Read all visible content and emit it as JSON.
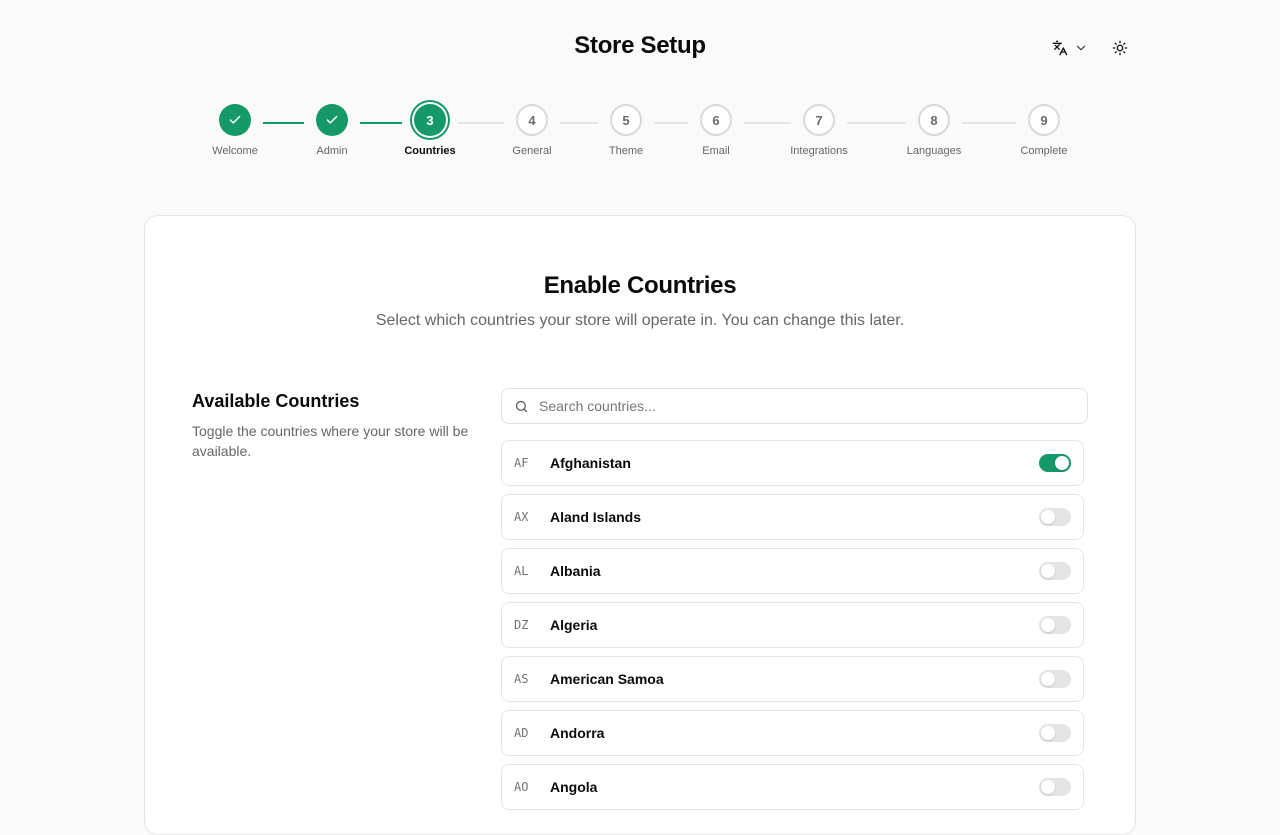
{
  "header": {
    "title": "Store Setup"
  },
  "colors": {
    "accent": "#169968"
  },
  "steps": [
    {
      "number": "1",
      "label": "Welcome",
      "state": "done"
    },
    {
      "number": "2",
      "label": "Admin",
      "state": "done"
    },
    {
      "number": "3",
      "label": "Countries",
      "state": "active"
    },
    {
      "number": "4",
      "label": "General",
      "state": "todo"
    },
    {
      "number": "5",
      "label": "Theme",
      "state": "todo"
    },
    {
      "number": "6",
      "label": "Email",
      "state": "todo"
    },
    {
      "number": "7",
      "label": "Integrations",
      "state": "todo"
    },
    {
      "number": "8",
      "label": "Languages",
      "state": "todo"
    },
    {
      "number": "9",
      "label": "Complete",
      "state": "todo"
    }
  ],
  "card": {
    "title": "Enable Countries",
    "subtitle": "Select which countries your store will operate in. You can change this later."
  },
  "side": {
    "title": "Available Countries",
    "description": "Toggle the countries where your store will be available."
  },
  "search": {
    "placeholder": "Search countries..."
  },
  "countries": [
    {
      "code": "AF",
      "name": "Afghanistan",
      "enabled": true
    },
    {
      "code": "AX",
      "name": "Aland Islands",
      "enabled": false
    },
    {
      "code": "AL",
      "name": "Albania",
      "enabled": false
    },
    {
      "code": "DZ",
      "name": "Algeria",
      "enabled": false
    },
    {
      "code": "AS",
      "name": "American Samoa",
      "enabled": false
    },
    {
      "code": "AD",
      "name": "Andorra",
      "enabled": false
    },
    {
      "code": "AO",
      "name": "Angola",
      "enabled": false
    }
  ]
}
